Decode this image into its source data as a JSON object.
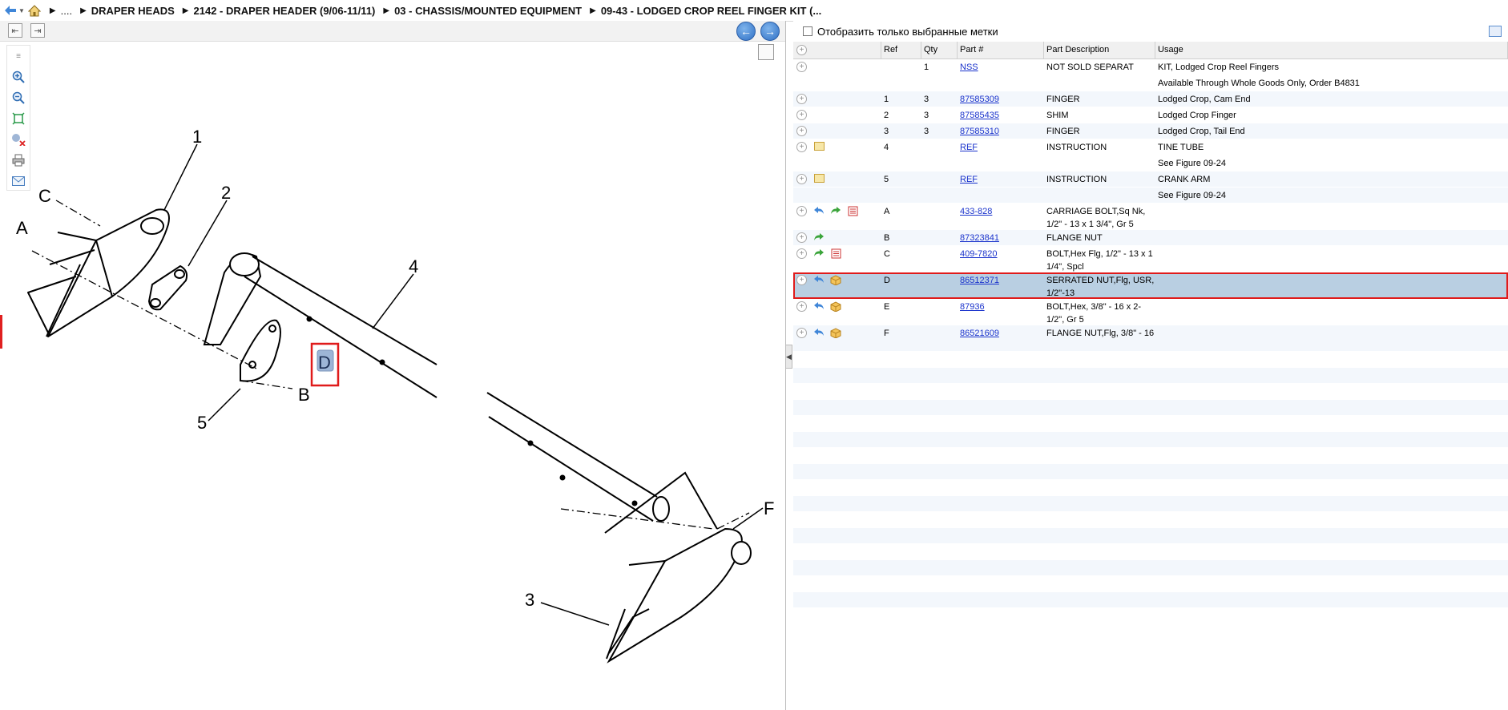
{
  "breadcrumb": {
    "items": [
      "....",
      "DRAPER HEADS",
      "2142 - DRAPER HEADER (9/06-11/11)",
      "03 - CHASSIS/MOUNTED EQUIPMENT",
      "09-43 - LODGED CROP REEL FINGER KIT (..."
    ]
  },
  "filter": {
    "label": "Отобразить только выбранные метки",
    "checked": false
  },
  "table": {
    "headers": {
      "ref": "Ref",
      "qty": "Qty",
      "part": "Part #",
      "desc": "Part Description",
      "usage": "Usage"
    },
    "rows": [
      {
        "ref": "",
        "qty": "1",
        "part": "NSS",
        "desc": "NOT SOLD SEPARAT",
        "usage": "KIT, Lodged Crop Reel Fingers",
        "icons": [],
        "plus": true
      },
      {
        "ref": "",
        "qty": "",
        "part": "",
        "desc": "",
        "usage": "Available Through Whole Goods Only, Order B4831",
        "icons": [],
        "plus": false
      },
      {
        "ref": "1",
        "qty": "3",
        "part": "87585309",
        "desc": "FINGER",
        "usage": "Lodged Crop, Cam End",
        "icons": [],
        "plus": true
      },
      {
        "ref": "2",
        "qty": "3",
        "part": "87585435",
        "desc": "SHIM",
        "usage": "Lodged Crop Finger",
        "icons": [],
        "plus": true
      },
      {
        "ref": "3",
        "qty": "3",
        "part": "87585310",
        "desc": "FINGER",
        "usage": "Lodged Crop, Tail End",
        "icons": [],
        "plus": true
      },
      {
        "ref": "4",
        "qty": "",
        "part": "REF",
        "desc": "INSTRUCTION",
        "usage": "TINE TUBE",
        "icons": [
          "note-icon"
        ],
        "plus": true
      },
      {
        "ref": "",
        "qty": "",
        "part": "",
        "desc": "",
        "usage": "See Figure 09-24",
        "icons": [],
        "plus": false
      },
      {
        "ref": "5",
        "qty": "",
        "part": "REF",
        "desc": "INSTRUCTION",
        "usage": "CRANK ARM",
        "icons": [
          "note-icon"
        ],
        "plus": true
      },
      {
        "ref": "",
        "qty": "",
        "part": "",
        "desc": "",
        "usage": "See Figure 09-24",
        "icons": [],
        "plus": false
      },
      {
        "ref": "A",
        "qty": "",
        "part": "433-828",
        "desc": "CARRIAGE BOLT,Sq Nk, 1/2\" - 13 x 1 3/4\", Gr 5",
        "usage": "",
        "icons": [
          "back-arrow-icon",
          "forward-arrow-icon",
          "list-icon"
        ],
        "plus": true
      },
      {
        "ref": "B",
        "qty": "",
        "part": "87323841",
        "desc": "FLANGE NUT",
        "usage": "",
        "icons": [
          "forward-arrow-icon"
        ],
        "plus": true
      },
      {
        "ref": "C",
        "qty": "",
        "part": "409-7820",
        "desc": "BOLT,Hex Flg, 1/2\" - 13 x 1 1/4\", Spcl",
        "usage": "",
        "icons": [
          "forward-arrow-icon",
          "list-icon"
        ],
        "plus": true
      },
      {
        "ref": "D",
        "qty": "",
        "part": "86512371",
        "desc": "SERRATED NUT,Flg, USR, 1/2\"-13",
        "usage": "",
        "icons": [
          "back-arrow-icon",
          "box-icon"
        ],
        "plus": true,
        "selected": true
      },
      {
        "ref": "E",
        "qty": "",
        "part": "87936",
        "desc": "BOLT,Hex, 3/8\" - 16 x 2-1/2\", Gr 5",
        "usage": "",
        "icons": [
          "back-arrow-icon",
          "box-icon"
        ],
        "plus": true
      },
      {
        "ref": "F",
        "qty": "",
        "part": "86521609",
        "desc": "FLANGE NUT,Flg, 3/8\" - 16",
        "usage": "",
        "icons": [
          "back-arrow-icon",
          "box-icon"
        ],
        "plus": true
      }
    ]
  },
  "diagram": {
    "callouts": {
      "n1": "1",
      "n2": "2",
      "n3": "3",
      "n4": "4",
      "n5": "5",
      "A": "A",
      "B": "B",
      "C": "C",
      "D": "D",
      "F": "F"
    }
  },
  "colors": {
    "selected_row": "#b9cfe2",
    "highlight": "#e01b1b",
    "link": "#1a33cc",
    "accent": "#2f70c5"
  }
}
